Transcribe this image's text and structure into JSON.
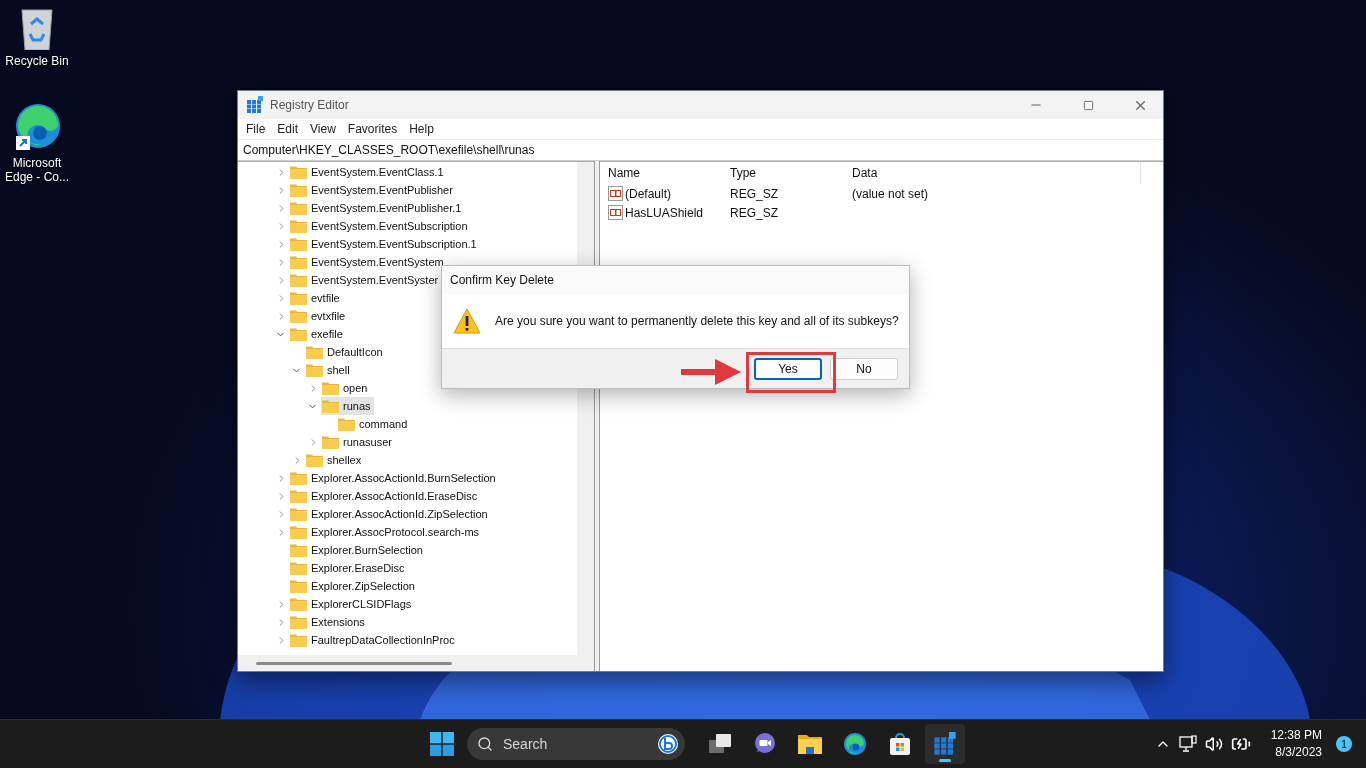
{
  "desktop_icons": [
    {
      "kind": "recycle-bin",
      "label": "Recycle Bin"
    },
    {
      "kind": "browser",
      "label": "Microsoft Edge - Co..."
    }
  ],
  "window": {
    "title": "Registry Editor",
    "menu": [
      "File",
      "Edit",
      "View",
      "Favorites",
      "Help"
    ],
    "address": "Computer\\HKEY_CLASSES_ROOT\\exefile\\shell\\runas"
  },
  "tree": [
    {
      "label": "EventSystem.EventClass.1",
      "expanded": false,
      "selected": false
    },
    {
      "label": "EventSystem.EventPublisher",
      "expanded": false,
      "selected": false
    },
    {
      "label": "EventSystem.EventPublisher.1",
      "expanded": false,
      "selected": false
    },
    {
      "label": "EventSystem.EventSubscription",
      "expanded": false,
      "selected": false
    },
    {
      "label": "EventSystem.EventSubscription.1",
      "expanded": false,
      "selected": false
    },
    {
      "label": "EventSystem.EventSystem",
      "expanded": false,
      "selected": false
    },
    {
      "label": "EventSystem.EventSyster",
      "expanded": false,
      "selected": false
    },
    {
      "label": "evtfile",
      "expanded": false,
      "selected": false
    },
    {
      "label": "evtxfile",
      "expanded": false,
      "selected": false
    },
    {
      "label": "exefile",
      "expanded": true,
      "selected": false,
      "children": [
        {
          "label": "DefaultIcon",
          "selected": false
        },
        {
          "label": "shell",
          "expanded": true,
          "selected": false,
          "children": [
            {
              "label": "open",
              "expanded": false,
              "selected": false
            },
            {
              "label": "runas",
              "expanded": true,
              "selected": true,
              "children": [
                {
                  "label": "command",
                  "selected": false
                }
              ]
            },
            {
              "label": "runasuser",
              "expanded": false,
              "selected": false
            }
          ]
        },
        {
          "label": "shellex",
          "expanded": false,
          "selected": false
        }
      ]
    },
    {
      "label": "Explorer.AssocActionId.BurnSelection",
      "expanded": false,
      "selected": false
    },
    {
      "label": "Explorer.AssocActionId.EraseDisc",
      "expanded": false,
      "selected": false
    },
    {
      "label": "Explorer.AssocActionId.ZipSelection",
      "expanded": false,
      "selected": false
    },
    {
      "label": "Explorer.AssocProtocol.search-ms",
      "expanded": false,
      "selected": false
    },
    {
      "label": "Explorer.BurnSelection",
      "selected": false
    },
    {
      "label": "Explorer.EraseDisc",
      "selected": false
    },
    {
      "label": "Explorer.ZipSelection",
      "selected": false
    },
    {
      "label": "ExplorerCLSIDFlags",
      "expanded": false,
      "selected": false
    },
    {
      "label": "Extensions",
      "expanded": false,
      "selected": false
    },
    {
      "label": "FaultrepDataCollectionInProc",
      "expanded": false,
      "selected": false
    }
  ],
  "values": {
    "columns": [
      "Name",
      "Type",
      "Data"
    ],
    "rows": [
      {
        "name": "(Default)",
        "type": "REG_SZ",
        "data": "(value not set)"
      },
      {
        "name": "HasLUAShield",
        "type": "REG_SZ"
      }
    ]
  },
  "dialog": {
    "title": "Confirm Key Delete",
    "message": "Are you sure you want to permanently delete this key and all of its subkeys?",
    "buttons": [
      {
        "label": "Yes",
        "selected": true
      },
      {
        "label": "No",
        "selected": false
      }
    ]
  },
  "taskbar": {
    "search_placeholder": "Search",
    "apps": [
      {
        "kind": "task-view",
        "active": false
      },
      {
        "kind": "chat",
        "active": false
      },
      {
        "kind": "files",
        "active": false
      },
      {
        "kind": "browser",
        "active": false
      },
      {
        "kind": "store",
        "active": false
      },
      {
        "kind": "registry",
        "active": true
      }
    ],
    "time": "12:38 PM",
    "date": "8/3/2023",
    "notification_count": "1"
  }
}
